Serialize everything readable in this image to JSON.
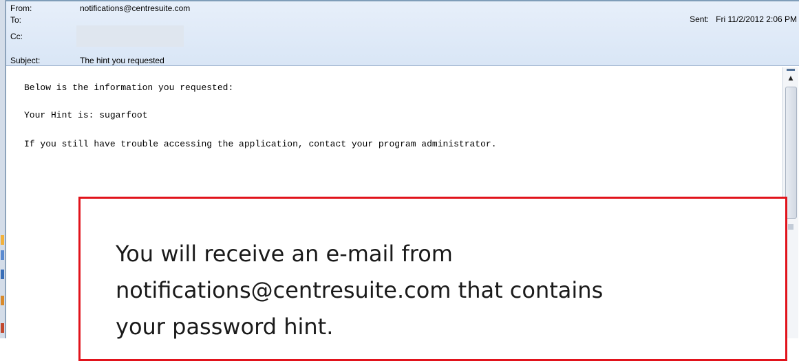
{
  "email_header": {
    "from_label": "From:",
    "from_value": "notifications@centresuite.com",
    "to_label": "To:",
    "to_value": "",
    "cc_label": "Cc:",
    "cc_value": "",
    "subject_label": "Subject:",
    "subject_value": "The hint you requested",
    "sent_label": "Sent:",
    "sent_value": "Fri 11/2/2012 2:06 PM"
  },
  "email_body": {
    "line1": "Below is the information you requested:",
    "line2": "Your Hint is: sugarfoot",
    "line3": "If you still have trouble accessing the application, contact your program administrator."
  },
  "callout": {
    "line1": "You will receive an e-mail from",
    "line2": "notifications@centresuite.com that contains",
    "line3": "your password hint.",
    "border_color": "#e1131b"
  },
  "colors": {
    "header_bg": "#dfe8f5",
    "accent": "#7f9db9"
  }
}
